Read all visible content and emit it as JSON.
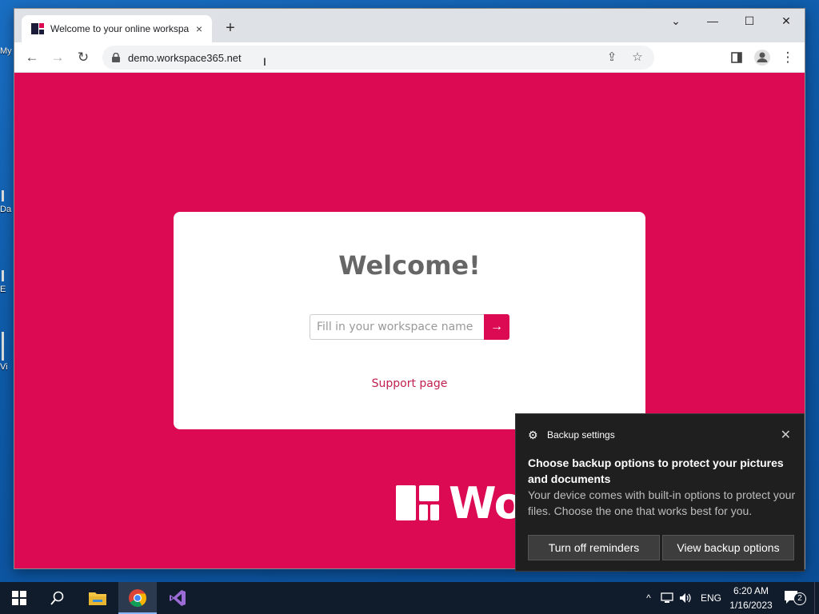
{
  "desktop": {
    "icons": [
      {
        "label": "My"
      },
      {
        "label": "Da"
      },
      {
        "label": "E"
      },
      {
        "label": "Vi"
      }
    ]
  },
  "browser": {
    "tab": {
      "title": "Welcome to your online workspa",
      "close": "×"
    },
    "new_tab": "+",
    "window_controls": {
      "tabsearch": "⌄",
      "minimize": "—",
      "maximize": "☐",
      "close": "✕"
    },
    "nav": {
      "back": "←",
      "forward": "→",
      "reload": "↻"
    },
    "url": "demo.workspace365.net",
    "toolbar_icons": [
      "share-icon",
      "star-icon",
      "sidepanel-icon",
      "profile-icon",
      "menu-icon"
    ]
  },
  "page": {
    "heading": "Welcome!",
    "workspace_input": {
      "value": "",
      "placeholder": "Fill in your workspace name"
    },
    "go_button": "→",
    "support_link": "Support page",
    "logo_text": "Wo",
    "background_color": "#dc0a52"
  },
  "toast": {
    "app": "Backup settings",
    "title": "Choose backup options to protect your pictures and documents",
    "body": "Your device comes with built-in options to protect your files. Choose the one that works best for you.",
    "buttons": {
      "turn_off": "Turn off reminders",
      "view": "View backup options"
    }
  },
  "taskbar": {
    "tray": {
      "language": "ENG",
      "time": "6:20 AM",
      "date": "1/16/2023",
      "notifications": "2"
    }
  }
}
